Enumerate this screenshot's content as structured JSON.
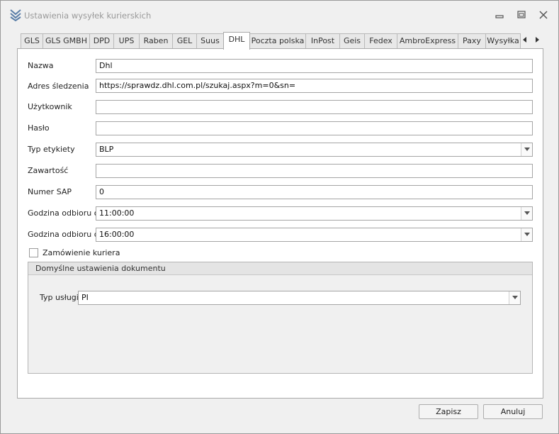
{
  "window": {
    "title": "Ustawienia wysyłek kurierskich",
    "colors": {
      "background": "#f0f0f0",
      "content": "#ffffff",
      "border": "#a9a9a9",
      "title_text": "#999999",
      "app_icon": "#5b7fa8"
    }
  },
  "tabs": [
    {
      "label": "GLS",
      "active": false
    },
    {
      "label": "GLS GMBH",
      "active": false
    },
    {
      "label": "DPD",
      "active": false
    },
    {
      "label": "UPS",
      "active": false
    },
    {
      "label": "Raben",
      "active": false
    },
    {
      "label": "GEL",
      "active": false
    },
    {
      "label": "Suus",
      "active": false
    },
    {
      "label": "DHL",
      "active": true
    },
    {
      "label": "Poczta polska",
      "active": false
    },
    {
      "label": "InPost",
      "active": false
    },
    {
      "label": "Geis",
      "active": false
    },
    {
      "label": "Fedex",
      "active": false
    },
    {
      "label": "AmbroExpress",
      "active": false
    },
    {
      "label": "Paxy",
      "active": false
    },
    {
      "label": "Wysyłka",
      "active": false
    }
  ],
  "form": {
    "nazwa": {
      "label": "Nazwa",
      "value": "Dhl"
    },
    "adres": {
      "label": "Adres śledzenia",
      "value": "https://sprawdz.dhl.com.pl/szukaj.aspx?m=0&sn="
    },
    "uzytkownik": {
      "label": "Użytkownik",
      "value": ""
    },
    "haslo": {
      "label": "Hasło",
      "value": ""
    },
    "typ_etykiety": {
      "label": "Typ etykiety",
      "value": "BLP"
    },
    "zawartosc": {
      "label": "Zawartość",
      "value": ""
    },
    "numer_sap": {
      "label": "Numer SAP",
      "value": "0"
    },
    "odbior_od": {
      "label": "Godzina odbioru od",
      "value": "11:00:00"
    },
    "odbior_do": {
      "label": "Godzina odbioru do",
      "value": "16:00:00"
    },
    "zamowienie": {
      "label": "Zamówienie kuriera",
      "checked": false
    }
  },
  "group": {
    "title": "Domyślne ustawienia dokumentu",
    "typ_uslugi": {
      "label": "Typ usługi",
      "value": "PI"
    }
  },
  "buttons": {
    "save": "Zapisz",
    "cancel": "Anuluj"
  }
}
